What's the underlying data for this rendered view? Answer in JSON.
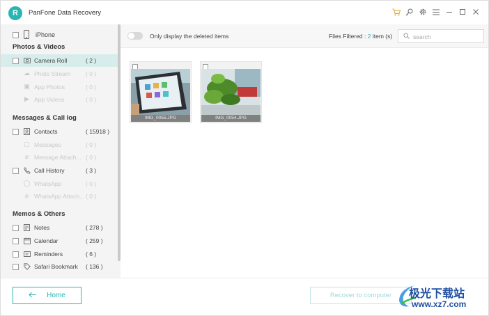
{
  "app": {
    "title": "PanFone Data Recovery",
    "logo_letter": "R",
    "accent_color": "#29b5b2",
    "title_icons": [
      "cart-icon",
      "key-icon",
      "gear-icon",
      "menu-icon",
      "minimize-icon",
      "maximize-icon",
      "close-icon"
    ]
  },
  "sidebar": {
    "device": "iPhone",
    "sections": [
      {
        "title": "Photos & Videos",
        "items": [
          {
            "label": "Camera Roll",
            "count": "( 2 )",
            "icon": "camera-icon",
            "state": "selected"
          },
          {
            "label": "Photo Stream",
            "count": "( 0 )",
            "icon": "cloud-photo-icon",
            "state": "disabled"
          },
          {
            "label": "App Photos",
            "count": "( 0 )",
            "icon": "image-icon",
            "state": "disabled"
          },
          {
            "label": "App Videos",
            "count": "( 0 )",
            "icon": "video-icon",
            "state": "disabled"
          }
        ]
      },
      {
        "title": "Messages & Call log",
        "items": [
          {
            "label": "Contacts",
            "count": "( 15918 )",
            "icon": "contacts-icon",
            "state": "normal"
          },
          {
            "label": "Messages",
            "count": "( 0 )",
            "icon": "message-icon",
            "state": "disabled"
          },
          {
            "label": "Message Attach...",
            "count": "( 0 )",
            "icon": "attachment-icon",
            "state": "disabled"
          },
          {
            "label": "Call History",
            "count": "( 3 )",
            "icon": "phone-icon",
            "state": "normal"
          },
          {
            "label": "WhatsApp",
            "count": "( 0 )",
            "icon": "whatsapp-icon",
            "state": "disabled"
          },
          {
            "label": "WhatsApp Attach...",
            "count": "( 0 )",
            "icon": "attachment-icon",
            "state": "disabled"
          }
        ]
      },
      {
        "title": "Memos & Others",
        "items": [
          {
            "label": "Notes",
            "count": "( 278 )",
            "icon": "notes-icon",
            "state": "normal"
          },
          {
            "label": "Calendar",
            "count": "( 259 )",
            "icon": "calendar-icon",
            "state": "normal"
          },
          {
            "label": "Reminders",
            "count": "( 6 )",
            "icon": "reminders-icon",
            "state": "normal"
          },
          {
            "label": "Safari Bookmark",
            "count": "( 136 )",
            "icon": "bookmark-icon",
            "state": "normal"
          }
        ]
      }
    ]
  },
  "toolbar": {
    "toggle_label": "Only display the deleted items",
    "filtered_prefix": "Files Filtered : ",
    "filtered_count": "2",
    "filtered_suffix": " item (s)",
    "search_placeholder": "search"
  },
  "photos": [
    {
      "caption": "IMG_0055.JPG"
    },
    {
      "caption": "IMG_0054.JPG"
    }
  ],
  "bottom": {
    "home_label": "Home",
    "recover_label": "Recover to computer"
  },
  "watermark": {
    "text": "极光下载站",
    "url": "www.xz7.com"
  }
}
